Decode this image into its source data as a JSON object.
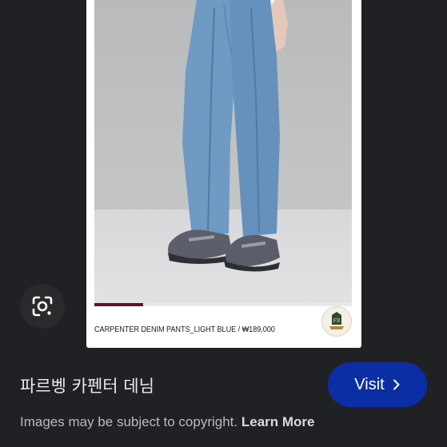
{
  "product": {
    "caption": "CARPENTER DENIM PANTS_LIGHT BLUE / ₩189,000",
    "image_alt": "Model wearing light blue carpenter denim pants and grey sneakers",
    "carousel_progress": 0.19
  },
  "result": {
    "title": "파르벵 카펜터 데님",
    "visit_label": "Visit"
  },
  "footer": {
    "copyright_text": "Images may be subject to copyright.",
    "learn_more_label": "Learn More"
  },
  "colors": {
    "background": "#202124",
    "visit_button": "#0b2ea4",
    "progress_accent": "#5a1626",
    "denim": "#6b97c1"
  },
  "icons": {
    "lens": "lens-icon",
    "chevron": "chevron-right-icon",
    "brand": "brand-logo-icon"
  }
}
